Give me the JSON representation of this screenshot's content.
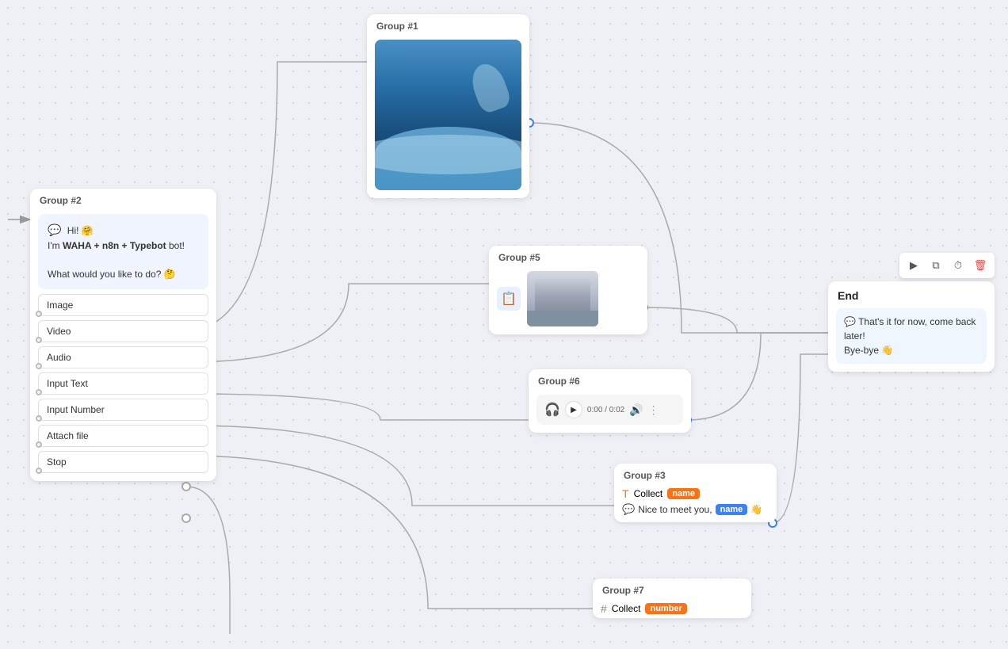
{
  "groups": {
    "group1": {
      "title": "Group #1",
      "type": "image",
      "image_alt": "Ocean wave"
    },
    "group2": {
      "title": "Group #2",
      "chat_message": "Hi! 🤗\nI'm WAHA + n8n + Typebot bot!\n\nWhat would you like to do? 🤔",
      "options": [
        "Image",
        "Video",
        "Audio",
        "Input Text",
        "Input Number",
        "Attach file",
        "Stop"
      ]
    },
    "group3": {
      "title": "Group #3",
      "collect_label": "Collect",
      "collect_var": "name",
      "message_prefix": "Nice to meet you,",
      "message_var": "name",
      "message_suffix": "👋"
    },
    "group5": {
      "title": "Group #5",
      "type": "file"
    },
    "group6": {
      "title": "Group #6",
      "type": "audio",
      "time_current": "0:00",
      "time_total": "0:02"
    },
    "group7": {
      "title": "Group #7",
      "collect_label": "Collect",
      "collect_var": "number"
    },
    "end": {
      "title": "End",
      "message": "That's it for now, come back later!\nBye-bye 👋"
    }
  },
  "toolbar": {
    "play": "▶",
    "copy": "⧉",
    "clock": "🕐",
    "delete": "🗑"
  }
}
